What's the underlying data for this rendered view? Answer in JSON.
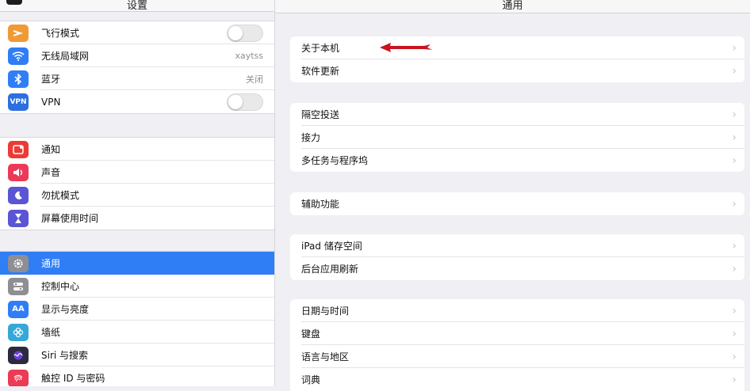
{
  "sidebar": {
    "title": "设置",
    "group1": [
      {
        "label": "飞行模式",
        "icon": "airplane-icon",
        "color": "#f09a37",
        "control": "toggle",
        "on": false
      },
      {
        "label": "无线局域网",
        "icon": "wifi-icon",
        "color": "#2f7ef5",
        "value": "xaytss"
      },
      {
        "label": "蓝牙",
        "icon": "bluetooth-icon",
        "color": "#2f7ef5",
        "value": "关闭"
      },
      {
        "label": "VPN",
        "icon": "vpn-icon",
        "color": "#2b6fe0",
        "iconText": "VPN",
        "control": "toggle",
        "on": false
      }
    ],
    "group2": [
      {
        "label": "通知",
        "icon": "notification-icon",
        "color": "#ec3b35"
      },
      {
        "label": "声音",
        "icon": "sound-icon",
        "color": "#eb3a58"
      },
      {
        "label": "勿扰模式",
        "icon": "moon-icon",
        "color": "#5a55d4"
      },
      {
        "label": "屏幕使用时间",
        "icon": "hourglass-icon",
        "color": "#5a55d4"
      }
    ],
    "group3": [
      {
        "label": "通用",
        "icon": "gear-icon",
        "color": "#8e8e93",
        "selected": true
      },
      {
        "label": "控制中心",
        "icon": "switches-icon",
        "color": "#8e8e93"
      },
      {
        "label": "显示与亮度",
        "icon": "aa-icon",
        "color": "#2f7ef5",
        "iconText": "AA"
      },
      {
        "label": "墙纸",
        "icon": "flower-icon",
        "color": "#36a8d8"
      },
      {
        "label": "Siri 与搜索",
        "icon": "siri-icon",
        "color": "#2b2b40"
      },
      {
        "label": "触控 ID 与密码",
        "icon": "fingerprint-icon",
        "color": "#ec3b55"
      }
    ]
  },
  "detail": {
    "title": "通用",
    "groups": [
      [
        "关于本机",
        "软件更新"
      ],
      [
        "隔空投送",
        "接力",
        "多任务与程序坞"
      ],
      [
        "辅助功能"
      ],
      [
        "iPad 储存空间",
        "后台应用刷新"
      ],
      [
        "日期与时间",
        "键盘",
        "语言与地区",
        "词典"
      ]
    ],
    "chevron": "›",
    "accent": "#c8141e"
  }
}
